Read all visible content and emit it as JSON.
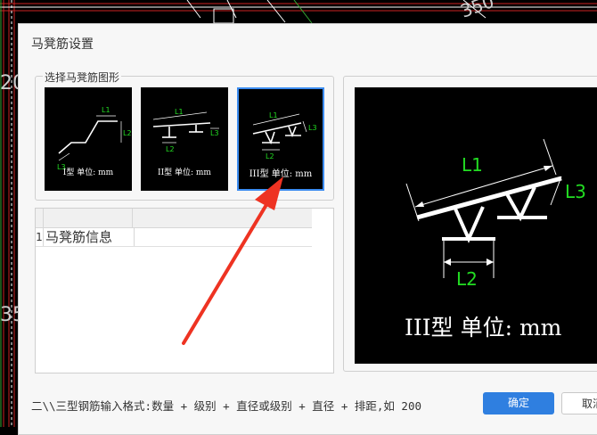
{
  "dialog": {
    "title": "马凳筋设置",
    "group_title": "选择马凳筋图形",
    "shapes": [
      {
        "id": "type1",
        "label": "I型 单位: mm",
        "dims": [
          "L1",
          "L2",
          "L3"
        ],
        "selected": false
      },
      {
        "id": "type2",
        "label": "II型 单位: mm",
        "dims": [
          "L1",
          "L2",
          "L3"
        ],
        "selected": false
      },
      {
        "id": "type3",
        "label": "III型 单位: mm",
        "dims": [
          "L1",
          "L2",
          "L3"
        ],
        "selected": true
      }
    ],
    "table": {
      "rows": [
        {
          "num": "1",
          "name": "马凳筋信息",
          "value": ""
        }
      ]
    },
    "preview": {
      "caption": "III型 单位: mm",
      "dims": [
        "L1",
        "L2",
        "L3"
      ]
    },
    "hint": "二\\\\三型钢筋输入格式:数量 + 级别 + 直径或级别 + 直径 + 排距,如 200",
    "ok_label": "确定",
    "cancel_label": "取消"
  },
  "colors": {
    "accent": "#2f7fe0",
    "dimension_green": "#22dd22",
    "annotation_arrow": "#ee3322",
    "cad_red": "#cc2222",
    "cad_green": "#33aa33"
  },
  "cad_background": {
    "visible_text": [
      "20",
      "35",
      "350"
    ]
  }
}
